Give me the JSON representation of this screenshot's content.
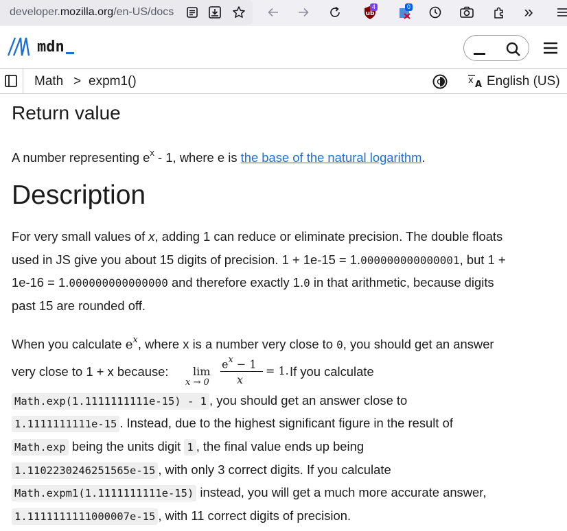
{
  "browser": {
    "url_prefix": "developer.",
    "url_domain": "mozilla.org",
    "url_path": "/en-US/docs",
    "ext_badge_1": "4",
    "ext_badge_2": "0",
    "more_label": "»"
  },
  "header": {
    "logo_mark": "M",
    "logo_text": "mdn"
  },
  "breadcrumb": {
    "items": [
      "Math",
      "expm1()"
    ],
    "separator": ">",
    "language": "English (US)"
  },
  "content": {
    "return_heading": "Return value",
    "return_text_1": "A number representing e",
    "return_sup": "x",
    "return_text_2": " - 1, where e is ",
    "return_link": "the base of the natural logarithm",
    "return_text_3": ".",
    "description_heading": "Description",
    "p1_line1_a": "For very small values of ",
    "p1_line1_x": "x",
    "p1_line1_b": ", adding 1 can reduce or eliminate precision. The double floats",
    "p1_line2_a": "used in JS give you about 15 digits of precision. 1 + 1e-15 = 1.",
    "p1_line2_num": "000000000000001",
    "p1_line2_b": ", but 1 +",
    "p1_line3_a": "1e-16 = 1.",
    "p1_line3_num": "000000000000000",
    "p1_line3_b": " and therefore exactly 1.",
    "p1_line3_zero": "0",
    "p1_line3_c": " in that arithmetic, because digits",
    "p1_line4": "past 15 are rounded off.",
    "p2_line1_a": "When you calculate ",
    "p2_line1_e": "e",
    "p2_line1_sup": "x",
    "p2_line1_b": ", where x is a number very close to ",
    "p2_line1_zero": "0",
    "p2_line1_c": ", you should get an answer",
    "p2_line2_a": "very close to 1 + x because: ",
    "p2_line2_b": " If you calculate",
    "math_lim": "lim",
    "math_sub": "x → 0",
    "math_num": "e",
    "math_num_sup": "x",
    "math_num_rest": " − 1",
    "math_den": "x",
    "math_eq": "= 1.",
    "p2_line3_code": "Math.exp(1.1111111111e-15) - 1",
    "p2_line3_b": ", you should get an answer close to",
    "p2_line4_code": "1.1111111111e-15",
    "p2_line4_b": ". Instead, due to the highest significant figure in the result of",
    "p2_line5_code": "Math.exp",
    "p2_line5_b": " being the units digit ",
    "p2_line5_code2": "1",
    "p2_line5_c": ", the final value ends up being",
    "p2_line6_code": "1.1102230246251565e-15",
    "p2_line6_b": ", with only 3 correct digits. If you calculate",
    "p2_line7_code": "Math.expm1(1.1111111111e-15)",
    "p2_line7_b": " instead, you will get a much more accurate answer,",
    "p2_line8_code": "1.1111111111000007e-15",
    "p2_line8_b": ", with 11 correct digits of precision."
  },
  "colors": {
    "link": "#1f6fd1",
    "code_bg": "#eeeeee",
    "chrome_bg": "#f0f0f4"
  }
}
